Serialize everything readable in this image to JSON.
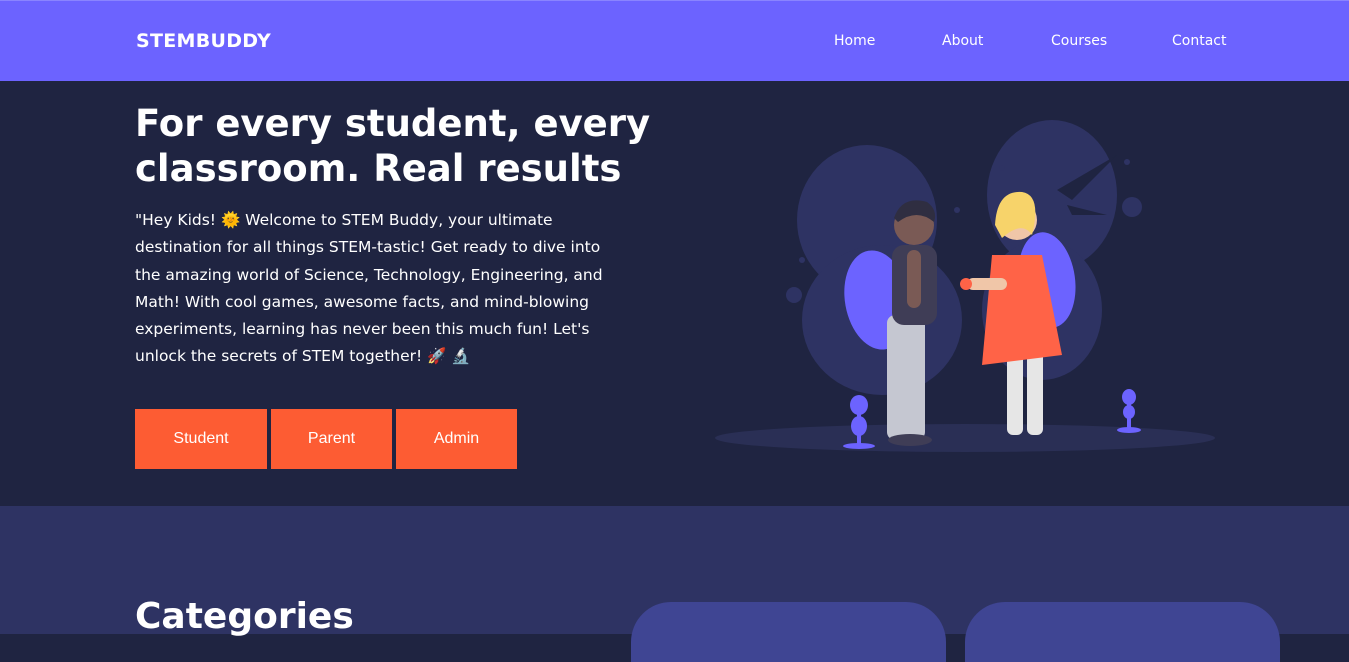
{
  "nav": {
    "logo": "STEMBUDDY",
    "links": [
      "Home",
      "About",
      "Courses",
      "Contact"
    ]
  },
  "hero": {
    "headline": "For every student, every classroom. Real results",
    "intro": "\"Hey Kids! 🌞 Welcome to STEM Buddy, your ultimate destination for all things STEM-tastic! Get ready to dive into the amazing world of Science, Technology, Engineering, and Math! With cool games, awesome facts, and mind-blowing experiments, learning has never been this much fun! Let's unlock the secrets of STEM together! 🚀 🔬",
    "buttons": [
      "Student",
      "Parent",
      "Admin"
    ]
  },
  "categories": {
    "title": "Categories"
  },
  "colors": {
    "nav_bg": "#6c63ff",
    "hero_bg": "#1f2441",
    "section_bg": "#2e3363",
    "button_bg": "#fd5c33",
    "card_bg": "#3f4593"
  }
}
